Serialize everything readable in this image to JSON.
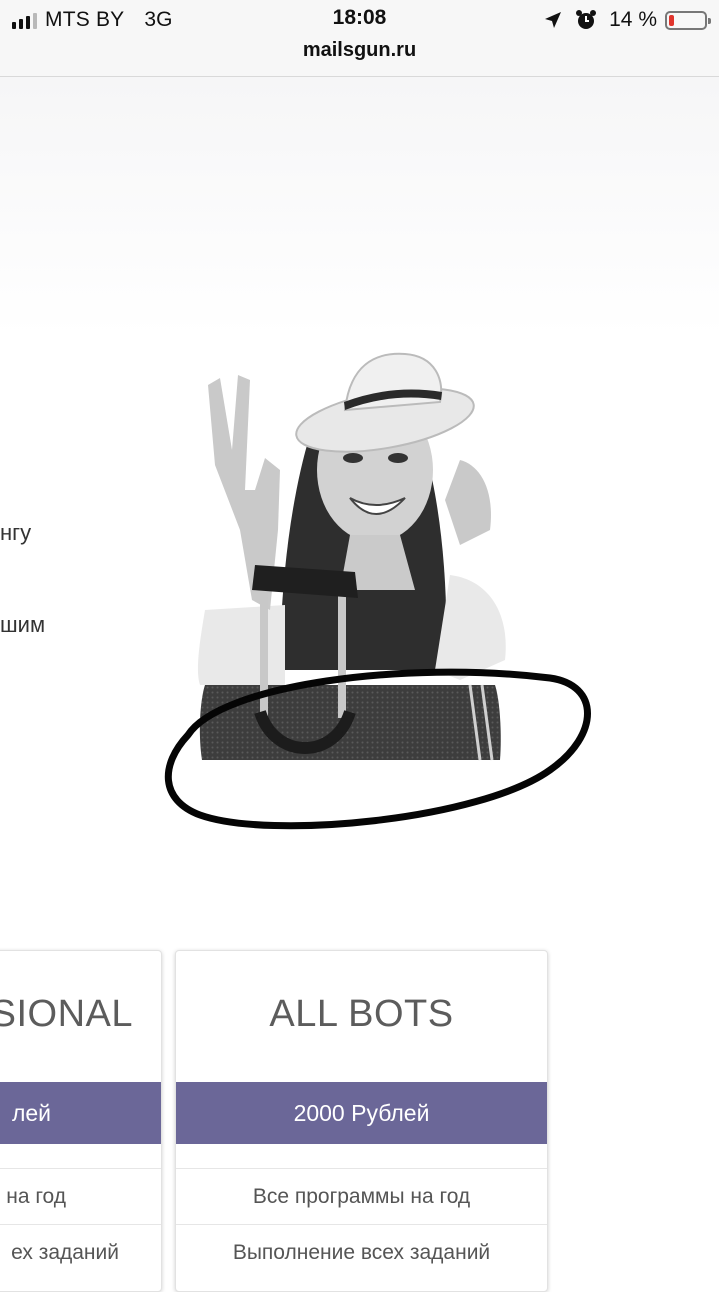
{
  "status_bar": {
    "carrier": "MTS BY",
    "network": "3G",
    "time": "18:08",
    "battery_percent": "14 %",
    "battery_level": 0.14,
    "battery_color": "#e0342c",
    "icons": [
      "signal-icon",
      "location-arrow-icon",
      "alarm-icon",
      "battery-icon"
    ]
  },
  "browser": {
    "url": "mailsgun.ru"
  },
  "hero": {
    "partial_text_1": "нгу",
    "partial_text_2": "шим",
    "image": "woman-with-hat-and-suitcase-photo",
    "annotation": "hand-drawn-black-ellipse"
  },
  "pricing": {
    "accent_color": "#6b6798",
    "cards": [
      {
        "title": "SIONAL",
        "price": "лей",
        "features": [
          "на год",
          "ех заданий"
        ]
      },
      {
        "title": "ALL BOTS",
        "price": "2000 Рублей",
        "features": [
          "Все программы на год",
          "Выполнение всех заданий"
        ]
      }
    ]
  }
}
